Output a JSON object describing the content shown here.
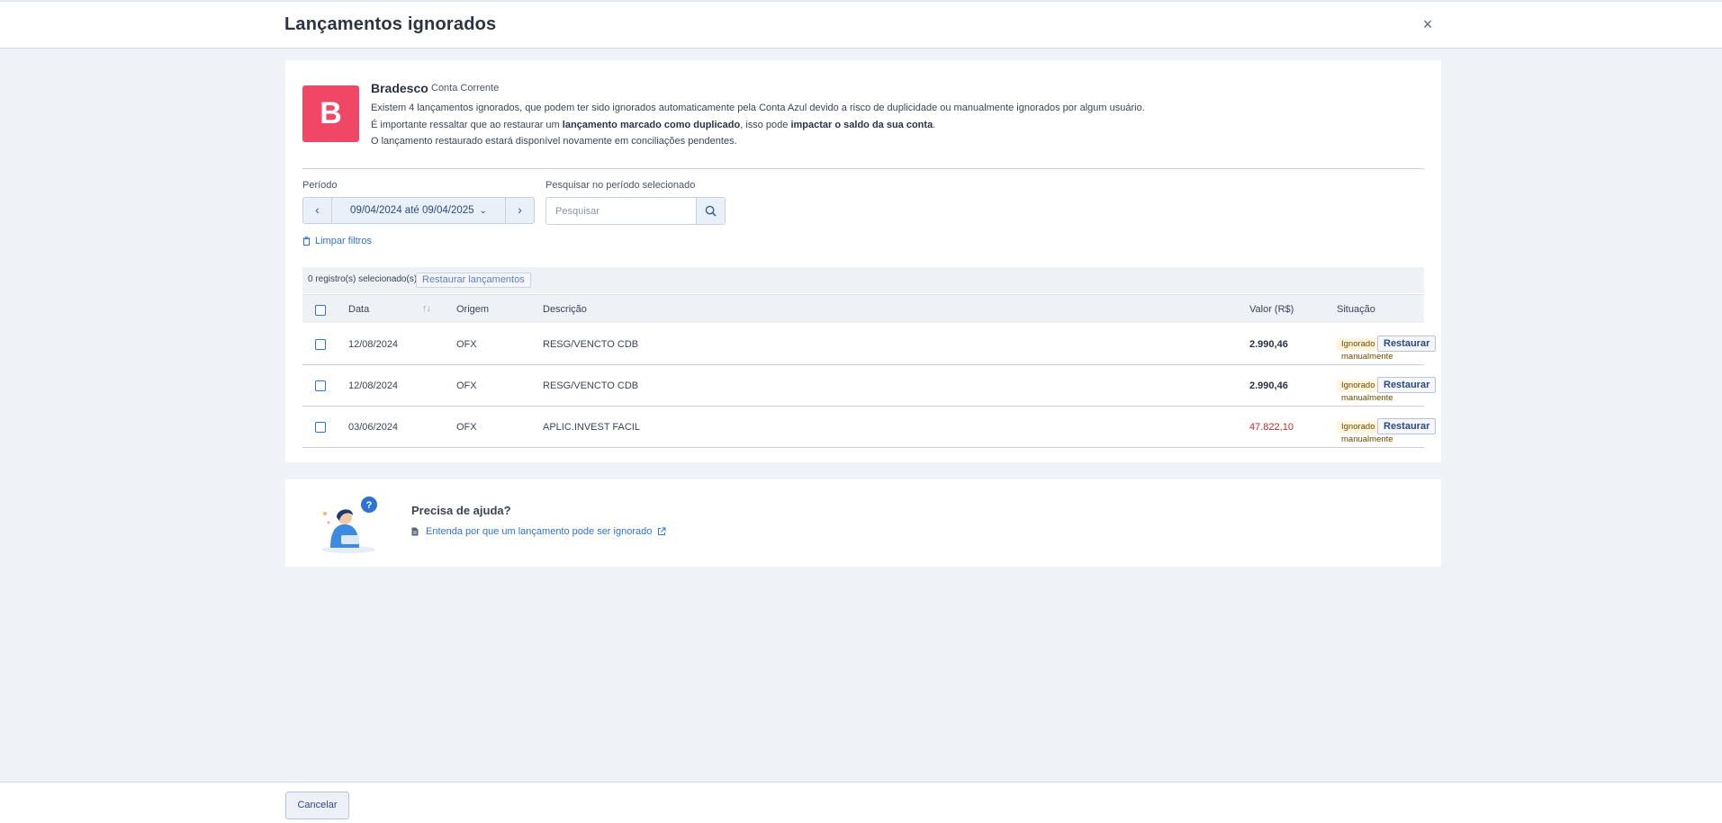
{
  "header": {
    "title": "Lançamentos ignorados",
    "close": "×"
  },
  "account": {
    "logo_letter": "B",
    "bank_name": "Bradesco",
    "account_type": "Conta Corrente",
    "info_line1": "Existem 4 lançamentos ignorados, que podem ter sido ignorados automaticamente pela Conta Azul devido a risco de duplicidade ou manualmente ignorados por algum usuário.",
    "info_line2_a": "É importante ressaltar que ao restaurar um ",
    "info_line2_b": "lançamento marcado como duplicado",
    "info_line2_c": ", isso pode ",
    "info_line2_d": "impactar o saldo da sua conta",
    "info_line2_e": ".",
    "info_line3": "O lançamento restaurado estará disponível novamente em conciliações pendentes."
  },
  "filters": {
    "period_label": "Período",
    "period_range": "09/04/2024 até 09/04/2025",
    "search_label": "Pesquisar no período selecionado",
    "search_placeholder": "Pesquisar",
    "search_value": "",
    "clear_filters": "Limpar filtros"
  },
  "bulk": {
    "selected_count": "0 registro(s) selecionado(s)",
    "restore_all": "Restaurar lançamentos"
  },
  "table": {
    "headers": {
      "date": "Data",
      "origin": "Origem",
      "description": "Descrição",
      "value": "Valor (R$)",
      "status": "Situação"
    },
    "rows": [
      {
        "date": "12/08/2024",
        "origin": "OFX",
        "description": "RESG/VENCTO CDB",
        "value": "2.990,46",
        "status": "Ignorado manualmente",
        "action": "Restaurar"
      },
      {
        "date": "12/08/2024",
        "origin": "OFX",
        "description": "RESG/VENCTO CDB",
        "value": "2.990,46",
        "status": "Ignorado manualmente",
        "action": "Restaurar"
      },
      {
        "date": "03/06/2024",
        "origin": "OFX",
        "description": "APLIC.INVEST FACIL",
        "value": "47.822,10",
        "status": "Ignorado manualmente",
        "action": "Restaurar"
      }
    ]
  },
  "help": {
    "title": "Precisa de ajuda?",
    "link": "Entenda por que um lançamento pode ser ignorado"
  },
  "footer": {
    "cancel": "Cancelar"
  },
  "colors": {
    "brand_logo": "#ef4765",
    "link": "#2e73d0",
    "negative_value": "#c62828",
    "badge_bg": "#fff4dd"
  }
}
